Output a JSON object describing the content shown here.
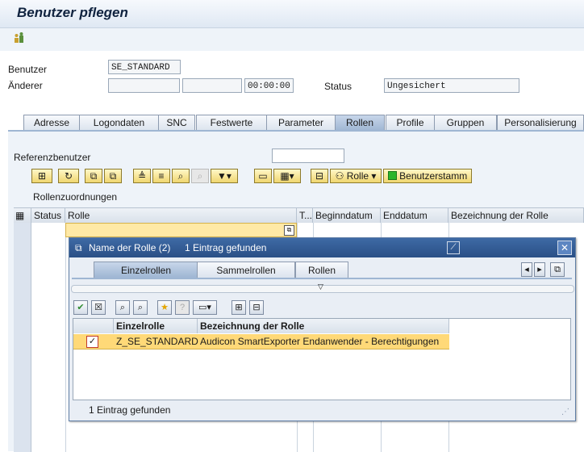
{
  "window": {
    "title": "Benutzer pflegen"
  },
  "header": {
    "user_label": "Benutzer",
    "user_value": "SE_STANDARD",
    "changer_label": "Änderer",
    "changer_value1": "",
    "changer_value2": "",
    "time_value": "00:00:00",
    "status_label": "Status",
    "status_value": "Ungesichert"
  },
  "tabs": [
    "Adresse",
    "Logondaten",
    "SNC",
    "Festwerte",
    "Parameter",
    "Rollen",
    "Profile",
    "Gruppen",
    "Personalisierung"
  ],
  "active_tab": "Rollen",
  "roles": {
    "ref_user_label": "Referenzbenutzer",
    "ref_user_value": "",
    "section_label": "Rollenzuordnungen",
    "role_button": "Rolle",
    "userstamm_button": "Benutzerstamm",
    "columns": [
      "Status",
      "Rolle",
      "T...",
      "Beginndatum",
      "Enddatum",
      "Bezeichnung der Rolle"
    ]
  },
  "popup": {
    "title": "Name der Rolle (2)",
    "count_text": "1 Eintrag gefunden",
    "tabs": [
      "Einzelrollen",
      "Sammelrollen",
      "Rollen"
    ],
    "columns": [
      "Einzelrolle",
      "Bezeichnung der Rolle"
    ],
    "rows": [
      {
        "role": "Z_SE_STANDARD",
        "desc": "Audicon SmartExporter Endanwender - Berechtigungen",
        "checked": true
      }
    ],
    "footer": "1 Eintrag gefunden"
  },
  "icons": {
    "toolbar_user": "users-icon",
    "popup_close": "close-icon"
  },
  "colors": {
    "title_blue": "#2a4f86",
    "selection": "#ffd978",
    "accent_green": "#2bb52b"
  }
}
